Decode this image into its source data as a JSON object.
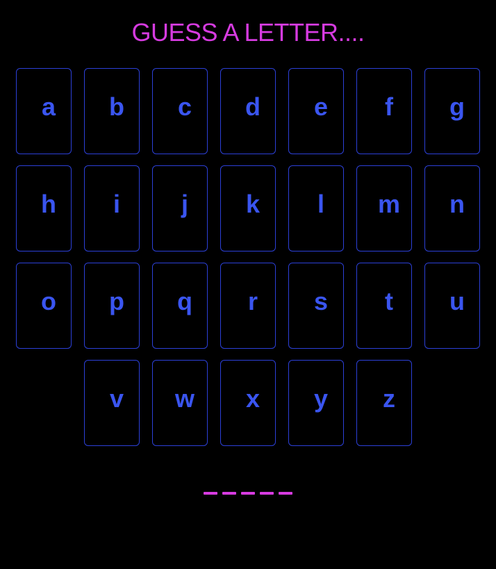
{
  "game": {
    "prompt": "GUESS A LETTER....",
    "keyboard_rows": [
      [
        "a",
        "b",
        "c",
        "d",
        "e",
        "f",
        "g"
      ],
      [
        "h",
        "i",
        "j",
        "k",
        "l",
        "m",
        "n"
      ],
      [
        "o",
        "p",
        "q",
        "r",
        "s",
        "t",
        "u"
      ],
      [
        "v",
        "w",
        "x",
        "y",
        "z"
      ]
    ],
    "word_length": 5
  },
  "colors": {
    "background": "#000000",
    "accent_magenta": "#d63be0",
    "key_border": "#2c40d8",
    "key_text": "#3a55f0"
  }
}
